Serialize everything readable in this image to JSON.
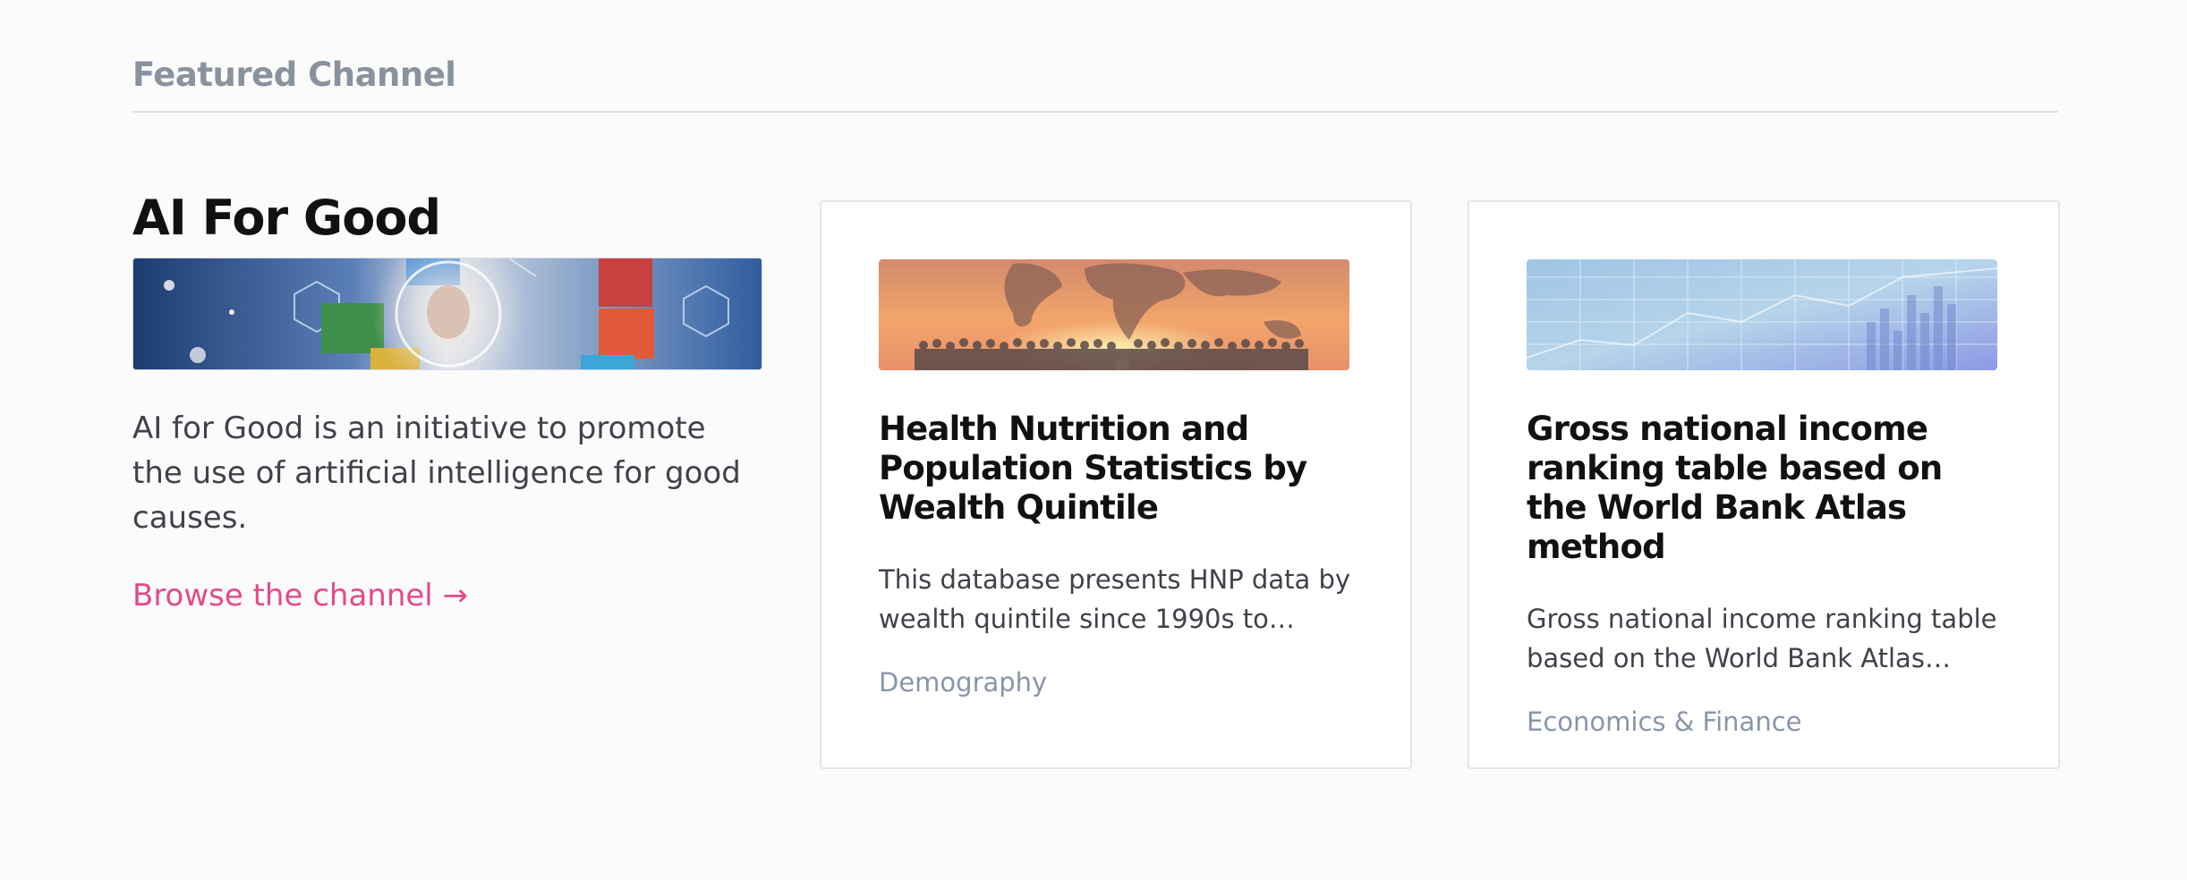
{
  "section": {
    "title": "Featured Channel"
  },
  "channel": {
    "name": "AI For Good",
    "description": "AI for Good is an initiative to promote the use of artificial intelligence for good causes.",
    "browse_label": "Browse the channel →"
  },
  "cards": [
    {
      "title": "Health Nutrition and Population Statistics by Wealth Quintile",
      "description": "This database presents HNP data by wealth quintile since 1990s to present.",
      "tag": "Demography"
    },
    {
      "title": "Gross national income ranking table based on the World Bank Atlas method",
      "description": "Gross national income ranking table based on the World Bank Atlas method.",
      "tag": "Economics & Finance"
    }
  ],
  "colors": {
    "accent": "#e5498a",
    "muted": "#8a95a8"
  }
}
